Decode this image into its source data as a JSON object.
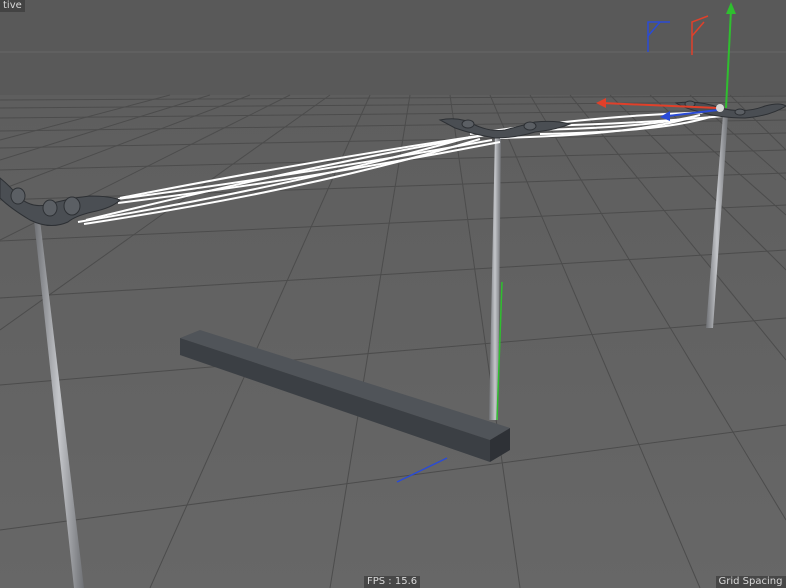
{
  "viewport": {
    "view_label": "tive",
    "fps_label": "FPS : ",
    "fps_value": "15.6",
    "grid_label": "Grid Spacing : "
  },
  "colors": {
    "background_top": "#5a5a5a",
    "floor": "#646464",
    "grid_line": "#4b4b4b",
    "wire": "#ffffff",
    "pole": "#9a9ca0",
    "beam": "#3e4247",
    "axis_x": "#e0402a",
    "axis_y": "#2fbf2f",
    "axis_z": "#2a4bd6"
  },
  "icons": {
    "camera_axis_gizmo": "axis-gizmo-icon",
    "move_handle": "move-gizmo-icon"
  }
}
